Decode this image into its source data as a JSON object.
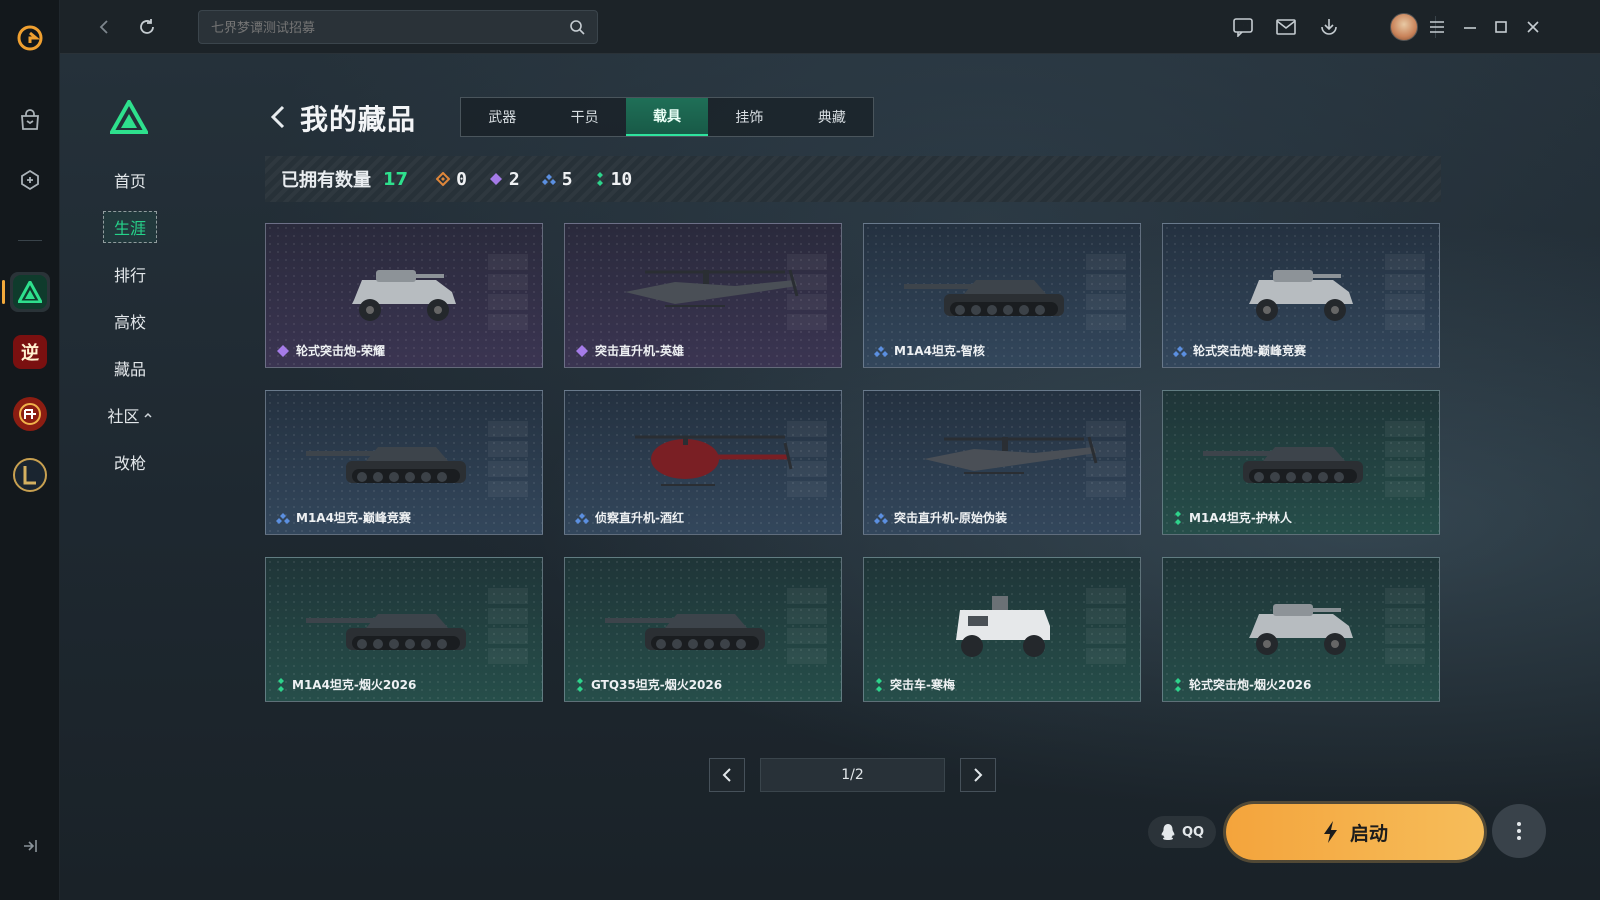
{
  "topbar": {
    "search_placeholder": "七界梦谭测试招募"
  },
  "side_nav": {
    "items": [
      {
        "label": "首页"
      },
      {
        "label": "生涯",
        "active": true
      },
      {
        "label": "排行"
      },
      {
        "label": "高校"
      },
      {
        "label": "藏品"
      },
      {
        "label": "社区",
        "expand_icon": "caret-up-icon"
      },
      {
        "label": "改枪"
      }
    ]
  },
  "rail": {
    "game_badges": [
      "逆"
    ]
  },
  "header": {
    "title": "我的藏品",
    "tabs": [
      {
        "label": "武器"
      },
      {
        "label": "干员"
      },
      {
        "label": "载具",
        "active": true
      },
      {
        "label": "挂饰"
      },
      {
        "label": "典藏"
      }
    ]
  },
  "stats": {
    "owned_label": "已拥有数量",
    "owned_total": "17",
    "tiers": [
      {
        "rarity": "orange",
        "color": "#e0873a",
        "count": "0"
      },
      {
        "rarity": "purple",
        "color": "#a57be8",
        "count": "2"
      },
      {
        "rarity": "blue",
        "color": "#5b8fe0",
        "count": "5"
      },
      {
        "rarity": "green",
        "color": "#2ed38b",
        "count": "10"
      }
    ]
  },
  "vehicles": [
    {
      "name": "轮式突击炮-荣耀",
      "rarity": "purple",
      "kind": "armored-car"
    },
    {
      "name": "突击直升机-英雄",
      "rarity": "purple",
      "kind": "attack-heli"
    },
    {
      "name": "M1A4坦克-智核",
      "rarity": "blue",
      "kind": "tank"
    },
    {
      "name": "轮式突击炮-巅峰竞赛",
      "rarity": "blue",
      "kind": "armored-car"
    },
    {
      "name": "M1A4坦克-巅峰竞赛",
      "rarity": "blue",
      "kind": "tank"
    },
    {
      "name": "侦察直升机-酒红",
      "rarity": "blue",
      "kind": "scout-heli"
    },
    {
      "name": "突击直升机-原始伪装",
      "rarity": "blue",
      "kind": "attack-heli"
    },
    {
      "name": "M1A4坦克-护林人",
      "rarity": "green",
      "kind": "tank"
    },
    {
      "name": "M1A4坦克-烟火2026",
      "rarity": "green",
      "kind": "tank"
    },
    {
      "name": "GTQ35坦克-烟火2026",
      "rarity": "green",
      "kind": "tank"
    },
    {
      "name": "突击车-寒梅",
      "rarity": "green",
      "kind": "truck"
    },
    {
      "name": "轮式突击炮-烟火2026",
      "rarity": "green",
      "kind": "armored-car"
    }
  ],
  "pager": {
    "indicator": "1/2"
  },
  "bottom": {
    "qq_label": "QQ",
    "launch_label": "启动"
  },
  "colors": {
    "accent_green": "#2ee08d",
    "launch_orange": "#f4a43c"
  }
}
